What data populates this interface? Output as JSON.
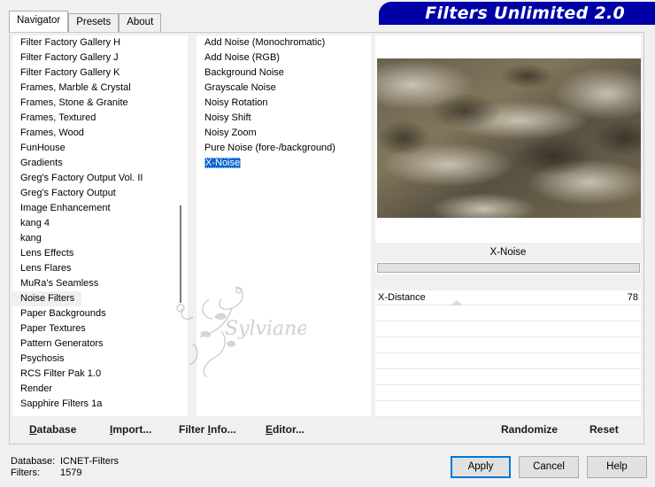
{
  "tabs": [
    {
      "label": "Navigator",
      "active": true
    },
    {
      "label": "Presets",
      "active": false
    },
    {
      "label": "About",
      "active": false
    }
  ],
  "header": {
    "title": "Filters Unlimited 2.0",
    "bar_color": "#0000a6"
  },
  "categories": {
    "items": [
      "Filter Factory Gallery H",
      "Filter Factory Gallery J",
      "Filter Factory Gallery K",
      "Frames, Marble & Crystal",
      "Frames, Stone & Granite",
      "Frames, Textured",
      "Frames, Wood",
      "FunHouse",
      "Gradients",
      "Greg's Factory Output Vol. II",
      "Greg's Factory Output",
      "Image Enhancement",
      "kang 4",
      "kang",
      "Lens Effects",
      "Lens Flares",
      "MuRa's Seamless",
      "Noise Filters",
      "Paper Backgrounds",
      "Paper Textures",
      "Pattern Generators",
      "Psychosis",
      "RCS Filter Pak 1.0",
      "Render",
      "Sapphire Filters 1a"
    ],
    "selected": "Noise Filters"
  },
  "filters": {
    "items": [
      "Add Noise (Monochromatic)",
      "Add Noise (RGB)",
      "Background Noise",
      "Grayscale Noise",
      "Noisy Rotation",
      "Noisy Shift",
      "Noisy Zoom",
      "Pure Noise (fore-/background)",
      "X-Noise"
    ],
    "selected": "X-Noise"
  },
  "preview": {
    "filter_name": "X-Noise"
  },
  "params": [
    {
      "label": "X-Distance",
      "value": "78"
    }
  ],
  "bottom_buttons": {
    "database": {
      "first": "D",
      "rest": "atabase"
    },
    "import": {
      "first": "I",
      "rest": "mport..."
    },
    "filter_info": {
      "pre": "Filter ",
      "first": "I",
      "rest": "nfo..."
    },
    "editor": {
      "first": "E",
      "rest": "ditor..."
    },
    "randomize": "Randomize",
    "reset": "Reset"
  },
  "status": {
    "database_label": "Database:",
    "database_value": "ICNET-Filters",
    "filters_label": "Filters:",
    "filters_value": "1579"
  },
  "dialog": {
    "apply": "Apply",
    "cancel": "Cancel",
    "help": "Help",
    "accent": "#0078d7"
  },
  "watermark": {
    "text": "Sylviane"
  }
}
